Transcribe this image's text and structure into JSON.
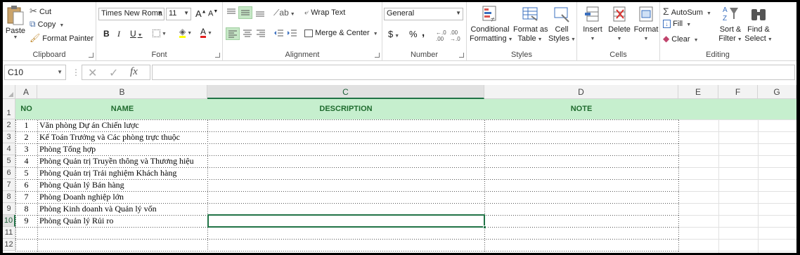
{
  "ribbon": {
    "clipboard": {
      "paste": "Paste",
      "cut": "Cut",
      "copy": "Copy",
      "format_painter": "Format Painter",
      "label": "Clipboard"
    },
    "font": {
      "name": "Times New Roma",
      "size": "11",
      "bold": "B",
      "italic": "I",
      "underline": "U",
      "label": "Font",
      "grow": "A",
      "shrink": "A",
      "font_color_glyph": "A"
    },
    "alignment": {
      "wrap_text": "Wrap Text",
      "merge_center": "Merge & Center",
      "label": "Alignment"
    },
    "number": {
      "format": "General",
      "currency": "$",
      "percent": "%",
      "comma": ",",
      "label": "Number"
    },
    "styles": {
      "conditional_formatting": [
        "Conditional",
        "Formatting"
      ],
      "format_as_table": [
        "Format as",
        "Table"
      ],
      "cell_styles": [
        "Cell",
        "Styles"
      ],
      "label": "Styles"
    },
    "cells": {
      "insert": "Insert",
      "delete": "Delete",
      "format": "Format",
      "label": "Cells"
    },
    "editing": {
      "autosum": "AutoSum",
      "fill": "Fill",
      "clear": "Clear",
      "sort_filter": [
        "Sort &",
        "Filter"
      ],
      "find_select": [
        "Find &",
        "Select"
      ],
      "label": "Editing"
    }
  },
  "formula_bar": {
    "name_box": "C10",
    "formula": ""
  },
  "sheet": {
    "columns": [
      "A",
      "B",
      "C",
      "D",
      "E",
      "F",
      "G"
    ],
    "active_column": "C",
    "active_row": "10",
    "rows": [
      "1",
      "2",
      "3",
      "4",
      "5",
      "6",
      "7",
      "8",
      "9",
      "10",
      "11",
      "12"
    ],
    "headers": {
      "no": "NO",
      "name": "NAME",
      "description": "DESCRIPTION",
      "note": "NOTE"
    },
    "data": [
      {
        "no": "1",
        "name": "Văn phòng Dự án Chiến lược"
      },
      {
        "no": "2",
        "name": "Kế Toán Trưởng và Các phòng trực thuộc"
      },
      {
        "no": "3",
        "name": "Phòng Tổng hợp"
      },
      {
        "no": "4",
        "name": "Phòng Quản trị Truyền thông và Thương hiệu"
      },
      {
        "no": "5",
        "name": "Phòng Quản trị Trải nghiệm Khách hàng"
      },
      {
        "no": "6",
        "name": "Phòng Quản lý Bán hàng"
      },
      {
        "no": "7",
        "name": "Phòng Doanh nghiệp lớn"
      },
      {
        "no": "8",
        "name": "Phòng Kinh doanh và Quản lý vốn"
      },
      {
        "no": "9",
        "name": "Phòng Quản lý Rủi ro"
      }
    ],
    "colors": {
      "header_fill": "#c6efce",
      "header_text": "#1f6b2e",
      "selection": "#217346"
    }
  }
}
